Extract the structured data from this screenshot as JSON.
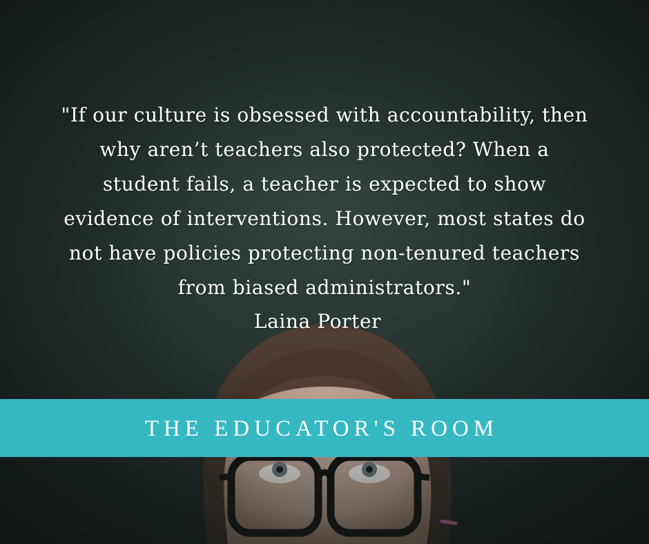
{
  "quote": {
    "text": "\"If our culture is obsessed with accountability, then\nwhy aren’t teachers also protected?  When a\nstudent fails, a teacher is expected to show\nevidence of interventions.  However, most states do\nnot have policies protecting non-tenured teachers\nfrom biased administrators.\"",
    "author": "Laina Porter"
  },
  "banner": {
    "label": "THE EDUCATOR'S ROOM",
    "color": "#36b8c2"
  }
}
